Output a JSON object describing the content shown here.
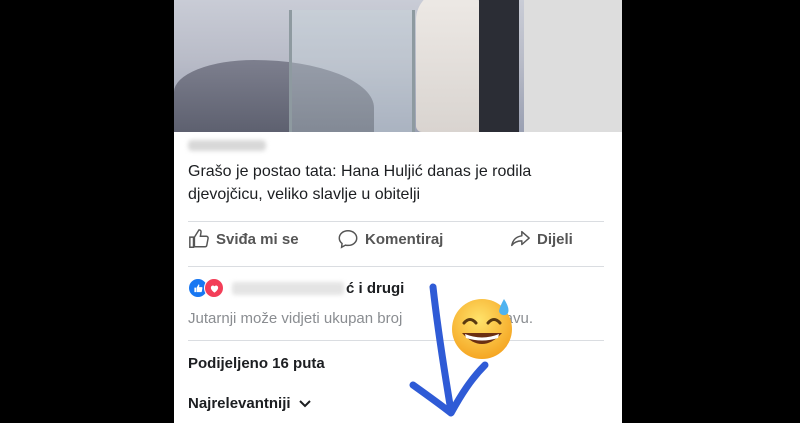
{
  "post": {
    "headline": "Grašo je postao tata: Hana Huljić danas je rodila djevojčicu, veliko slavlje u obitelji"
  },
  "actions": {
    "like_label": "Sviđa mi se",
    "comment_label": "Komentiraj",
    "share_label": "Dijeli"
  },
  "reactions": {
    "suffix": "ć i drugi",
    "note": "Jutarnji može vidjeti ukupan broj",
    "note_tail": "objavu."
  },
  "shares": {
    "label": "Podijeljeno 16 puta"
  },
  "sort": {
    "label": "Najrelevantniji"
  },
  "colors": {
    "like_blue": "#1877f2",
    "love_red": "#f33e58",
    "arrow_blue": "#2f5bd6"
  }
}
